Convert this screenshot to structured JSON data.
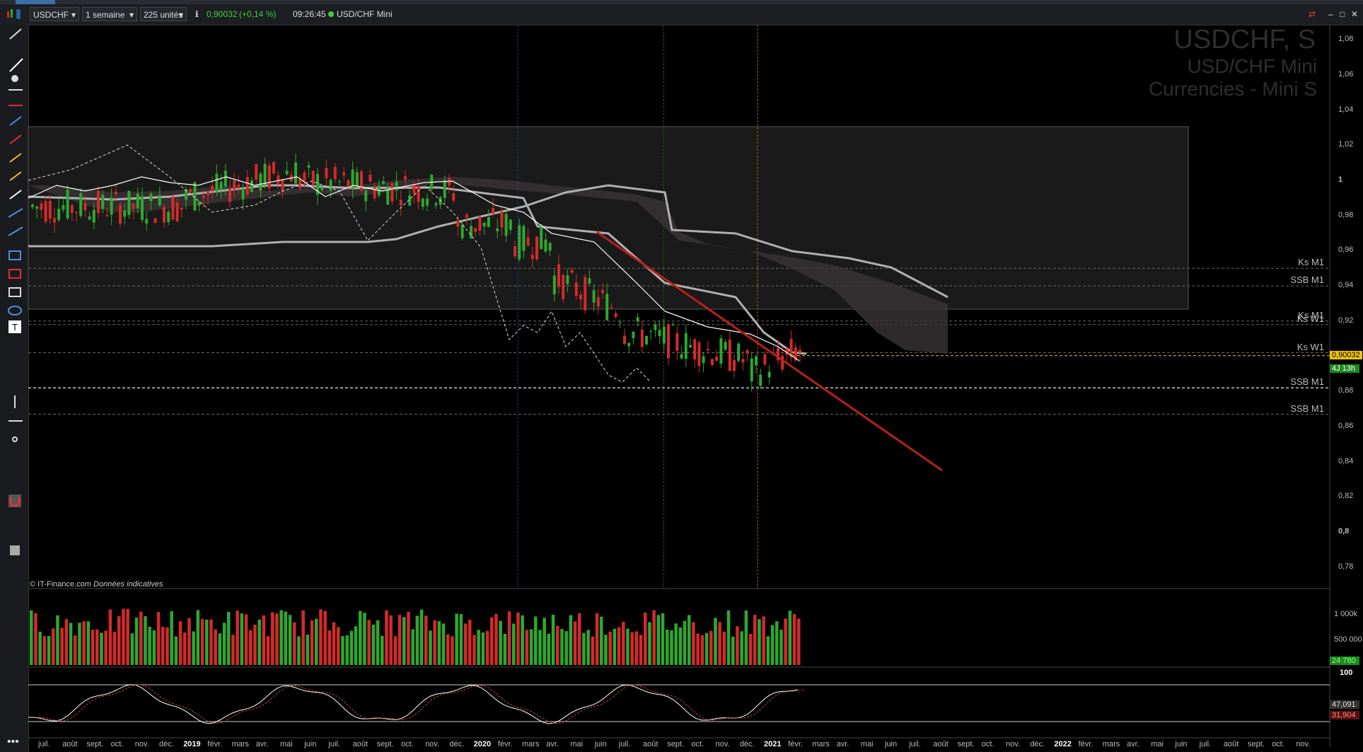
{
  "toolbar": {
    "symbol": "USDCHF",
    "period": "1 semaine",
    "units": "225 unités",
    "price": "0,90032",
    "change": "(+0,14 %)",
    "time": "09:26:45",
    "instrument": "USD/CHF Mini"
  },
  "watermark": {
    "line1": "USDCHF, S",
    "line2": "USD/CHF Mini",
    "line3": "Currencies - Mini S"
  },
  "copyright": "© IT-Finance.com",
  "copyright_note": "Données indicatives",
  "price_axis": [
    "1,08",
    "1,06",
    "1,04",
    "1,02",
    "1",
    "0,98",
    "0,96",
    "0,94",
    "0,92",
    "0,9",
    "0,88",
    "0,86",
    "0,84",
    "0,82",
    "0,8",
    "0,78"
  ],
  "price_tag": "0,90032",
  "time_tag": "4J 13h",
  "level_labels": [
    {
      "text": "Ks M1",
      "price": 0.95
    },
    {
      "text": "SSB M1",
      "price": 0.94
    },
    {
      "text": "Ks M1",
      "price": 0.92
    },
    {
      "text": "Ks W1",
      "price": 0.918
    },
    {
      "text": "Ks W1",
      "price": 0.902
    },
    {
      "text": "SSB M1",
      "price": 0.882
    },
    {
      "text": "SSB M1",
      "price": 0.867
    }
  ],
  "volume_axis": [
    "1 000k",
    "500 000"
  ],
  "volume_tag": "24 780",
  "osc_axis_top": "100",
  "osc_tag1": "47,091",
  "osc_tag2": "31,904",
  "time_axis": [
    "juil.",
    "août",
    "sept.",
    "oct.",
    "nov.",
    "déc.",
    "2019",
    "févr.",
    "mars",
    "avr.",
    "mai",
    "juin",
    "juil.",
    "août",
    "sept.",
    "oct.",
    "nov.",
    "déc.",
    "2020",
    "févr.",
    "mars",
    "avr.",
    "mai",
    "juin",
    "juil.",
    "août",
    "sept.",
    "oct.",
    "nov.",
    "déc.",
    "2021",
    "févr.",
    "mars",
    "avr.",
    "mai",
    "juin",
    "juil.",
    "août",
    "sept.",
    "oct.",
    "nov.",
    "déc.",
    "2022",
    "févr.",
    "mars",
    "avr.",
    "mai",
    "juin",
    "juil.",
    "août",
    "sept.",
    "oct.",
    "nov."
  ],
  "colors": {
    "up": "#2ea82e",
    "down": "#d42a2a",
    "trend": "#b81e1e",
    "cloud": "#3a3536"
  }
}
